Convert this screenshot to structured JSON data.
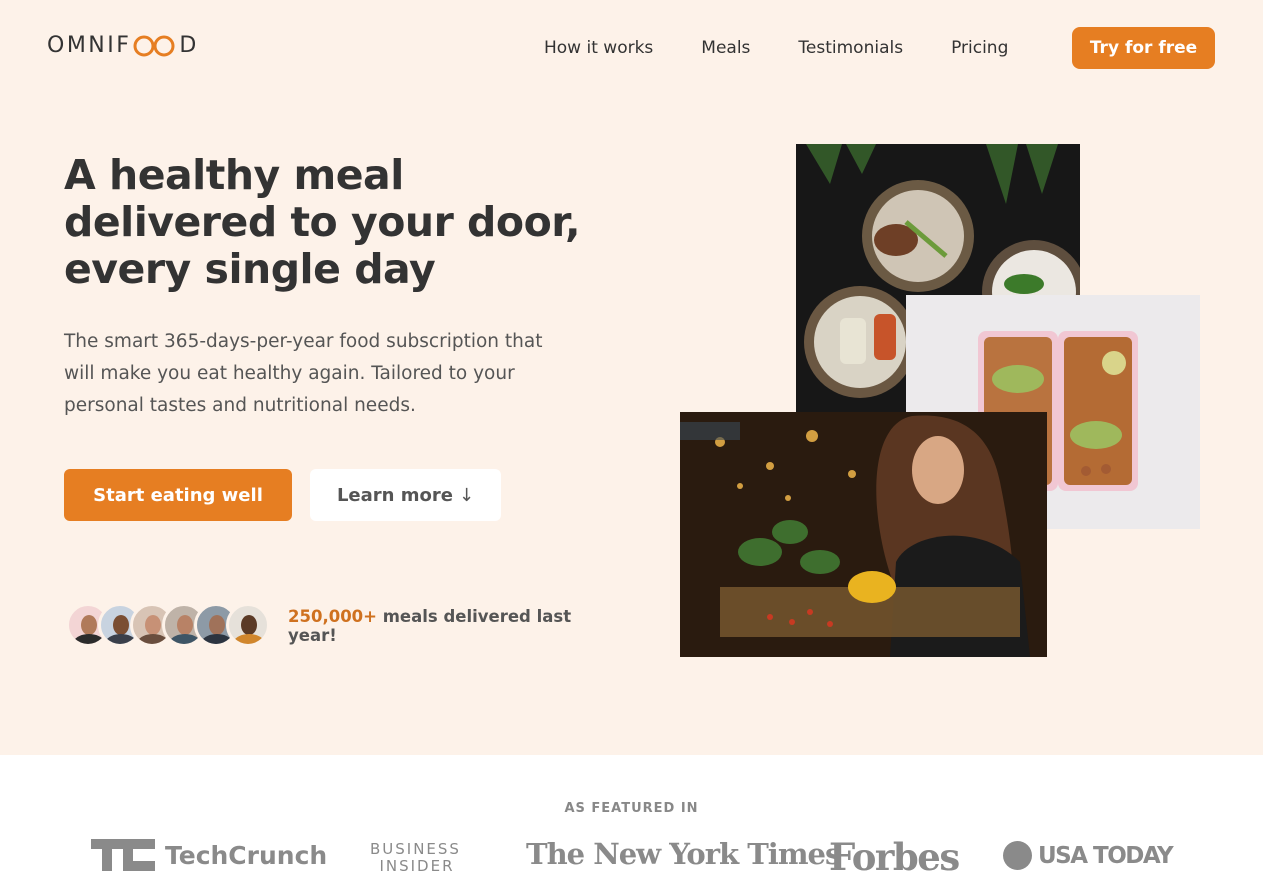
{
  "brand": {
    "logo_prefix": "OMNIF",
    "logo_suffix": "D",
    "accent_color": "#e67e22"
  },
  "nav": {
    "links": [
      "How it works",
      "Meals",
      "Testimonials",
      "Pricing"
    ],
    "cta": "Try for free"
  },
  "hero": {
    "title_line1": "A healthy meal",
    "title_line2": "delivered to your door,",
    "title_line3": "every single day",
    "description": "The smart 365-days-per-year food subscription that will make you eat healthy again. Tailored to your personal tastes and nutritional needs.",
    "primary_button": "Start eating well",
    "secondary_button": "Learn more",
    "secondary_arrow": "↓",
    "stat_highlight": "250,000+",
    "stat_text": "meals delivered last year!"
  },
  "featured": {
    "title": "AS FEATURED IN",
    "logos": {
      "techcrunch": "TechCrunch",
      "business_insider_1": "BUSINESS",
      "business_insider_2": "INSIDER",
      "nyt": "The New York Times",
      "forbes": "Forbes",
      "usa_today": "USA TODAY"
    }
  }
}
